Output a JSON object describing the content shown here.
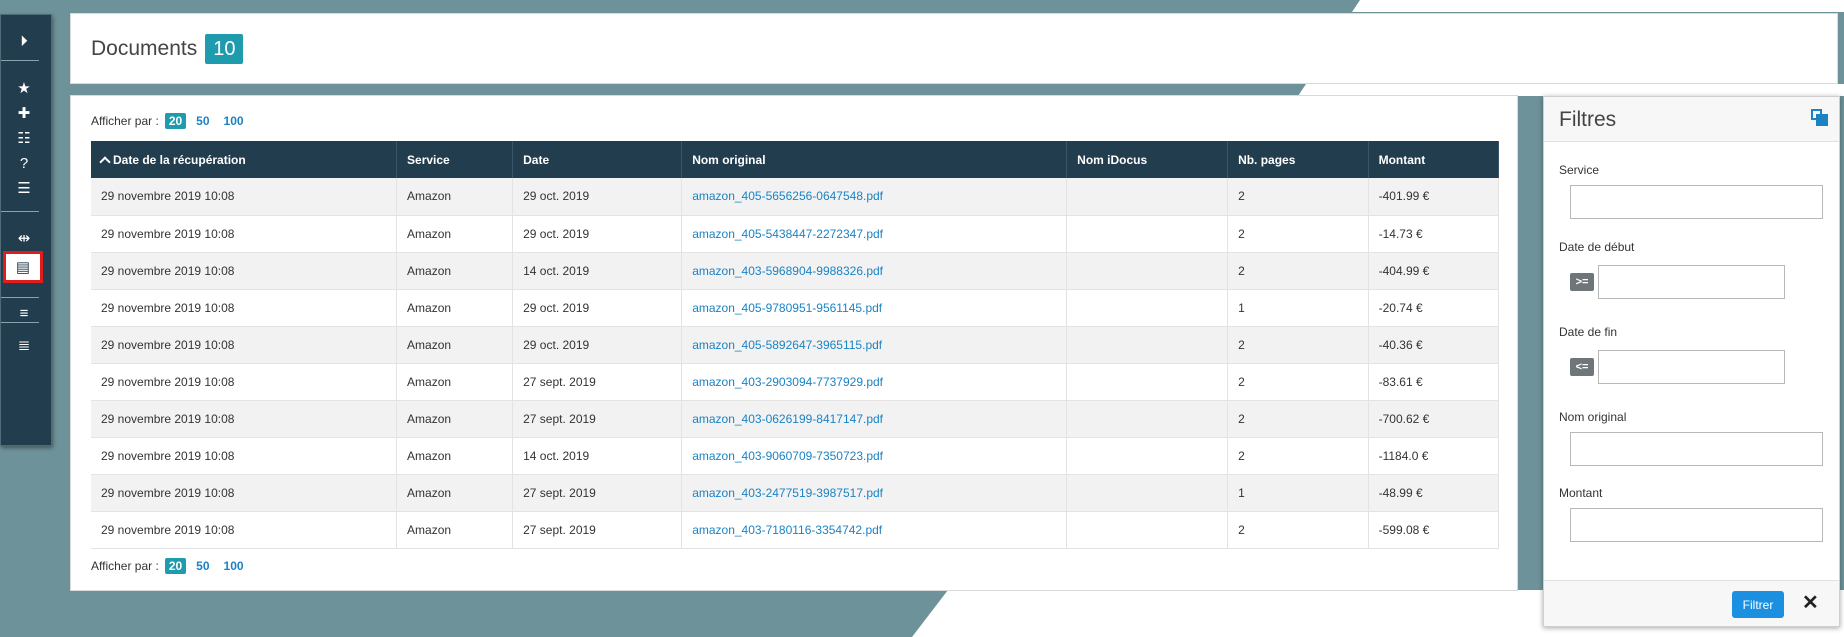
{
  "header": {
    "title": "Documents",
    "count": "10"
  },
  "sidebar": {
    "items": [
      {
        "name": "expand-arrow-icon",
        "glyph": "⏵"
      },
      {
        "name": "star-icon",
        "glyph": "★"
      },
      {
        "name": "plus-icon",
        "glyph": "✚"
      },
      {
        "name": "dashboard-list-icon",
        "glyph": "☷"
      },
      {
        "name": "help-icon",
        "glyph": "?"
      },
      {
        "name": "list-icon",
        "glyph": "☰"
      },
      {
        "name": "compare-icon",
        "glyph": "⇹"
      },
      {
        "name": "document-icon",
        "glyph": "▤"
      },
      {
        "name": "align-icon",
        "glyph": "≡"
      },
      {
        "name": "text-icon",
        "glyph": "≣"
      }
    ]
  },
  "pagination": {
    "label": "Afficher par :",
    "options": [
      "20",
      "50",
      "100"
    ],
    "selected": "20"
  },
  "table": {
    "columns": [
      "Date de la récupération",
      "Service",
      "Date",
      "Nom original",
      "Nom iDocus",
      "Nb. pages",
      "Montant"
    ],
    "rows": [
      [
        "29 novembre 2019 10:08",
        "Amazon",
        "29 oct. 2019",
        "amazon_405-5656256-0647548.pdf",
        "",
        "2",
        "-401.99 €"
      ],
      [
        "29 novembre 2019 10:08",
        "Amazon",
        "29 oct. 2019",
        "amazon_405-5438447-2272347.pdf",
        "",
        "2",
        "-14.73 €"
      ],
      [
        "29 novembre 2019 10:08",
        "Amazon",
        "14 oct. 2019",
        "amazon_403-5968904-9988326.pdf",
        "",
        "2",
        "-404.99 €"
      ],
      [
        "29 novembre 2019 10:08",
        "Amazon",
        "29 oct. 2019",
        "amazon_405-9780951-9561145.pdf",
        "",
        "1",
        "-20.74 €"
      ],
      [
        "29 novembre 2019 10:08",
        "Amazon",
        "29 oct. 2019",
        "amazon_405-5892647-3965115.pdf",
        "",
        "2",
        "-40.36 €"
      ],
      [
        "29 novembre 2019 10:08",
        "Amazon",
        "27 sept. 2019",
        "amazon_403-2903094-7737929.pdf",
        "",
        "2",
        "-83.61 €"
      ],
      [
        "29 novembre 2019 10:08",
        "Amazon",
        "27 sept. 2019",
        "amazon_403-0626199-8417147.pdf",
        "",
        "2",
        "-700.62 €"
      ],
      [
        "29 novembre 2019 10:08",
        "Amazon",
        "14 oct. 2019",
        "amazon_403-9060709-7350723.pdf",
        "",
        "2",
        "-1184.0 €"
      ],
      [
        "29 novembre 2019 10:08",
        "Amazon",
        "27 sept. 2019",
        "amazon_403-2477519-3987517.pdf",
        "",
        "1",
        "-48.99 €"
      ],
      [
        "29 novembre 2019 10:08",
        "Amazon",
        "27 sept. 2019",
        "amazon_403-7180116-3354742.pdf",
        "",
        "2",
        "-599.08 €"
      ]
    ]
  },
  "filters": {
    "title": "Filtres",
    "service_label": "Service",
    "start_label": "Date de début",
    "start_op": ">=",
    "end_label": "Date de fin",
    "end_op": "<=",
    "original_label": "Nom original",
    "amount_label": "Montant",
    "submit_label": "Filtrer",
    "close_glyph": "✕"
  },
  "colors": {
    "accent": "#1f9bae",
    "header_bg": "#223d4d",
    "link": "#1b83c4",
    "button": "#1b8fe0"
  }
}
